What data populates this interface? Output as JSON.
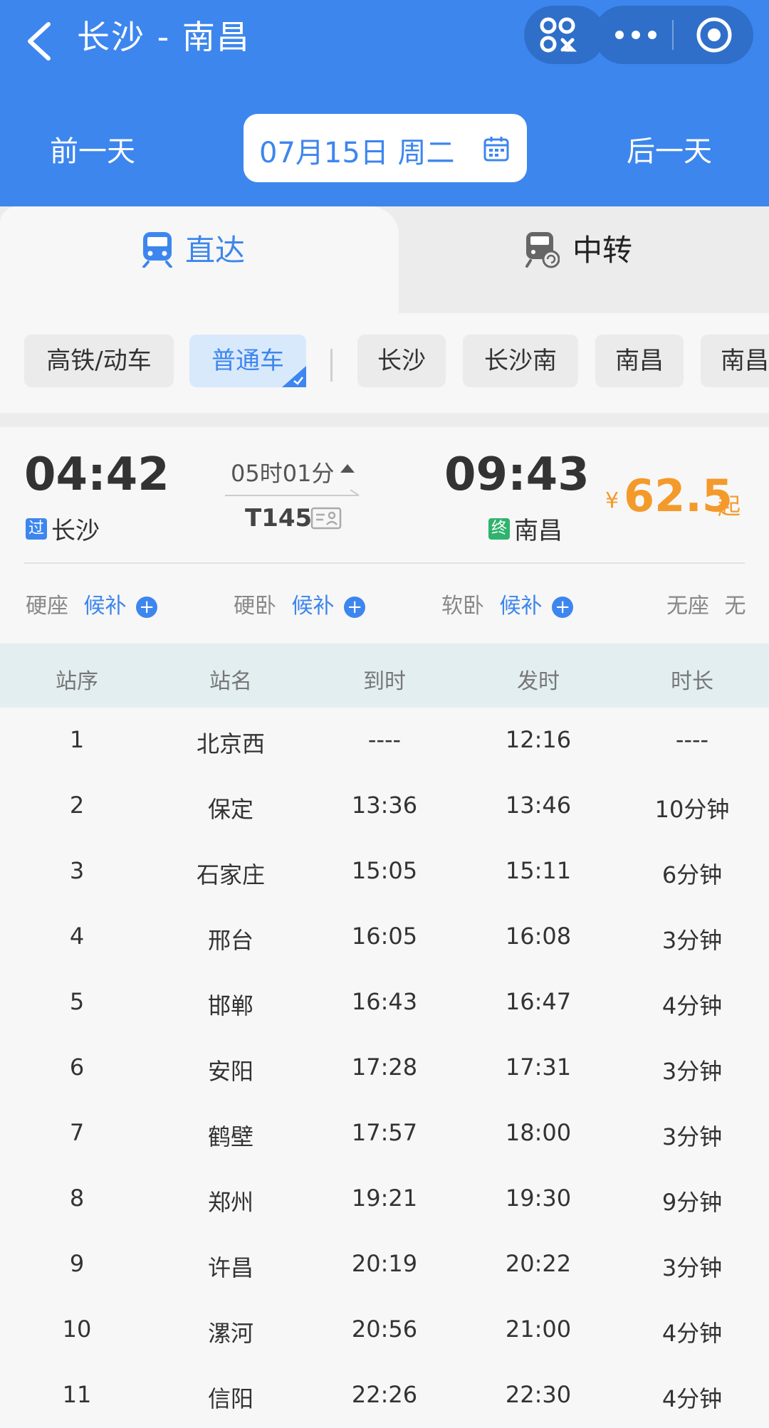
{
  "header": {
    "title": "长沙 - 南昌",
    "prev_day": "前一天",
    "date": "07月15日 周二",
    "next_day": "后一天"
  },
  "tabs": [
    {
      "label": "直达",
      "active": true
    },
    {
      "label": "中转",
      "active": false
    }
  ],
  "filters": [
    {
      "label": "高铁/动车",
      "active": false
    },
    {
      "label": "普通车",
      "active": true
    },
    {
      "label": "长沙",
      "active": false
    },
    {
      "label": "长沙南",
      "active": false
    },
    {
      "label": "南昌",
      "active": false
    },
    {
      "label": "南昌",
      "active": false
    }
  ],
  "train": {
    "depart_time": "04:42",
    "depart_badge": "过",
    "depart_station": "长沙",
    "duration": "05时01分",
    "train_no": "T145",
    "arrive_time": "09:43",
    "arrive_badge": "终",
    "arrive_station": "南昌",
    "price_symbol": "¥",
    "price": "62.5",
    "price_suffix": "起"
  },
  "seats": [
    {
      "type": "硬座",
      "status": "候补"
    },
    {
      "type": "硬卧",
      "status": "候补"
    },
    {
      "type": "软卧",
      "status": "候补"
    },
    {
      "type": "无座",
      "status": "无"
    }
  ],
  "timetable": {
    "headers": [
      "站序",
      "站名",
      "到时",
      "发时",
      "时长"
    ],
    "rows": [
      [
        "1",
        "北京西",
        "----",
        "12:16",
        "----"
      ],
      [
        "2",
        "保定",
        "13:36",
        "13:46",
        "10分钟"
      ],
      [
        "3",
        "石家庄",
        "15:05",
        "15:11",
        "6分钟"
      ],
      [
        "4",
        "邢台",
        "16:05",
        "16:08",
        "3分钟"
      ],
      [
        "5",
        "邯郸",
        "16:43",
        "16:47",
        "4分钟"
      ],
      [
        "6",
        "安阳",
        "17:28",
        "17:31",
        "3分钟"
      ],
      [
        "7",
        "鹤壁",
        "17:57",
        "18:00",
        "3分钟"
      ],
      [
        "8",
        "郑州",
        "19:21",
        "19:30",
        "9分钟"
      ],
      [
        "9",
        "许昌",
        "20:19",
        "20:22",
        "3分钟"
      ],
      [
        "10",
        "漯河",
        "20:56",
        "21:00",
        "4分钟"
      ],
      [
        "11",
        "信阳",
        "22:26",
        "22:30",
        "4分钟"
      ]
    ]
  },
  "colors": {
    "brand_blue": "#3d86ee",
    "price_orange": "#f39a2b",
    "terminal_green": "#2fb36e"
  }
}
